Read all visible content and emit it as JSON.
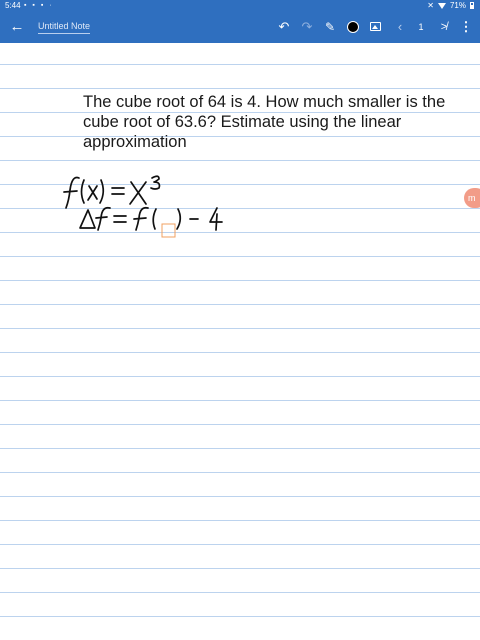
{
  "statusbar": {
    "time": "5:44",
    "icons": "▪ ▪ ▪ ·",
    "mute_icon": "🔇",
    "wifi_icon": "wifi-icon",
    "battery": "71%",
    "color": "#2f6fbf"
  },
  "toolbar": {
    "back_glyph": "←",
    "title": "Untitled Note",
    "undo_glyph": "↶",
    "redo_glyph": "↷",
    "pen_glyph": "✎",
    "pen_color": "#000000",
    "prev_glyph": "‹",
    "page": "1",
    "next_glyph": "≯",
    "more_glyph": "⋮"
  },
  "page": {
    "question": "The cube root of 64 is 4. How much smaller is the cube root of 63.6? Estimate using the linear approximation",
    "line_color": "#bcd3ee",
    "ink_color": "#111111",
    "handwriting": {
      "line1": "f(x) = x³",
      "line2": "Δf = f( ) - 4"
    },
    "cursor_color": "#f0a060"
  },
  "side_tab": {
    "label": "m",
    "color": "#f29c88"
  }
}
